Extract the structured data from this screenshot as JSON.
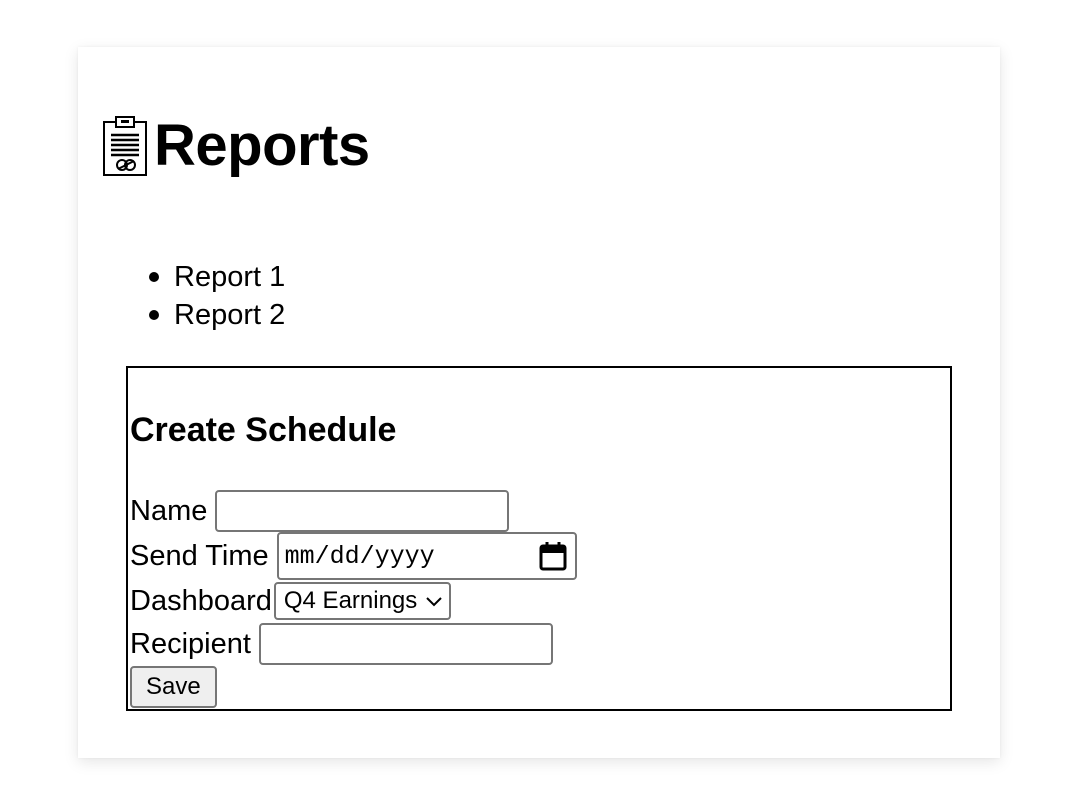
{
  "header": {
    "title": "Reports",
    "icon": "clipboard-icon"
  },
  "reports": {
    "items": [
      {
        "label": "Report 1"
      },
      {
        "label": "Report 2"
      }
    ]
  },
  "schedule": {
    "title": "Create Schedule",
    "name_label": "Name",
    "name_value": "",
    "send_time_label": "Send Time",
    "send_time_placeholder": "mm/dd/yyyy",
    "dashboard_label": "Dashboard",
    "dashboard_selected": "Q4 Earnings",
    "recipient_label": "Recipient",
    "recipient_value": "",
    "save_label": "Save"
  },
  "colors": {
    "border": "#767676",
    "button_bg": "#efefef",
    "text": "#000000"
  }
}
